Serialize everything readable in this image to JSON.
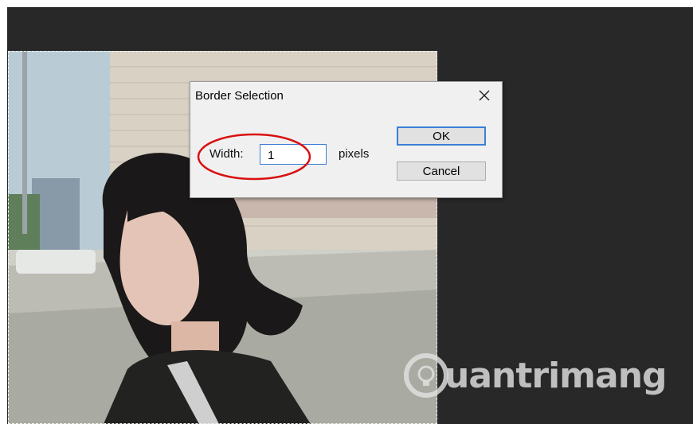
{
  "dialog": {
    "title": "Border Selection",
    "width_label": "Width:",
    "width_value": "1",
    "unit": "pixels",
    "ok_label": "OK",
    "cancel_label": "Cancel"
  },
  "watermark": {
    "text": "uantrimang"
  },
  "colors": {
    "workspace": "#282828",
    "dialog_bg": "#f0f0f0",
    "focus_blue": "#3c7fd6",
    "annotation_red": "#d81010"
  }
}
